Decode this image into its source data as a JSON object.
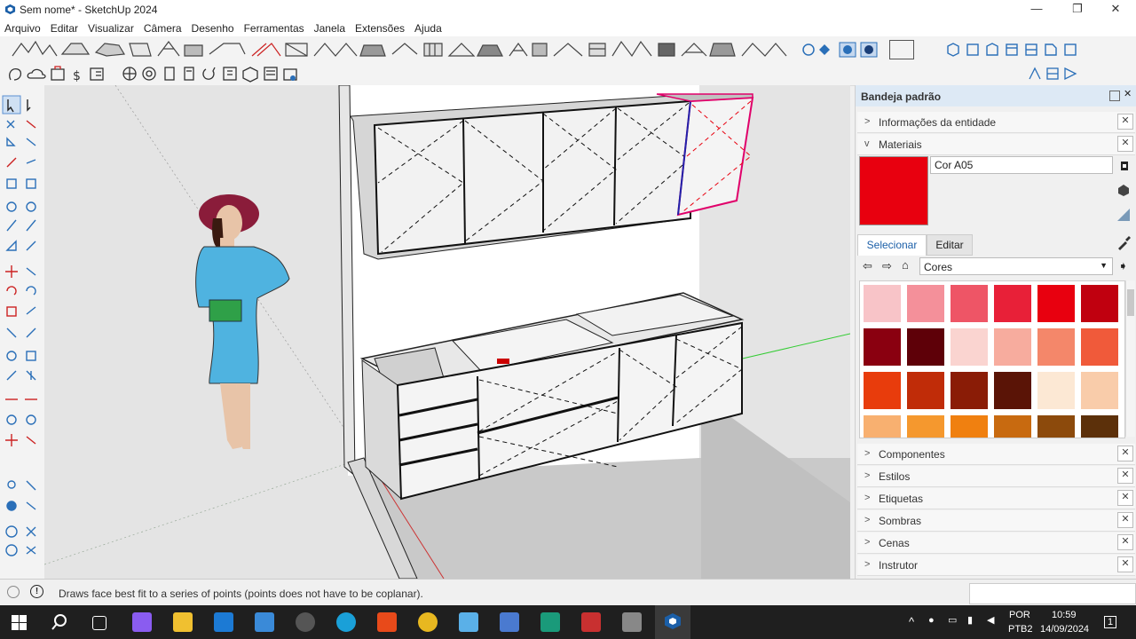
{
  "window": {
    "title": "Sem nome* - SketchUp 2024",
    "minimize": "—",
    "restore": "❐",
    "close": "✕"
  },
  "menu": [
    "Arquivo",
    "Editar",
    "Visualizar",
    "Câmera",
    "Desenho",
    "Ferramentas",
    "Janela",
    "Extensões",
    "Ajuda"
  ],
  "tray": {
    "title": "Bandeja padrão",
    "panels_top": [
      {
        "label": "Informações da entidade",
        "state": "collapsed"
      },
      {
        "label": "Materiais",
        "state": "expanded"
      }
    ],
    "materials": {
      "name": "Cor A05",
      "color": "#e8000f",
      "tabs": [
        "Selecionar",
        "Editar"
      ],
      "collection": "Cores",
      "swatches": [
        "#f8c4c8",
        "#f4909a",
        "#ee5566",
        "#e82038",
        "#e8000f",
        "#c0000f",
        "#8a0010",
        "#5e0008",
        "#fad4d0",
        "#f7ac9e",
        "#f4876a",
        "#f05a3a",
        "#e83c0c",
        "#c02c08",
        "#8a1c06",
        "#5a1406",
        "#fce8d4",
        "#f9ccaa",
        "#f8b070",
        "#f5982e",
        "#f08010",
        "#c86a10",
        "#8c4a0c",
        "#5c300a"
      ]
    },
    "panels_bottom": [
      {
        "label": "Componentes"
      },
      {
        "label": "Estilos"
      },
      {
        "label": "Etiquetas"
      },
      {
        "label": "Sombras"
      },
      {
        "label": "Cenas"
      },
      {
        "label": "Instrutor"
      }
    ]
  },
  "status": {
    "text": "Draws face best fit to a series of points (points does not have to be coplanar)."
  },
  "taskbar": {
    "language": "POR",
    "layout": "PTB2",
    "time": "10:59",
    "date": "14/09/2024",
    "notifications": "1"
  }
}
